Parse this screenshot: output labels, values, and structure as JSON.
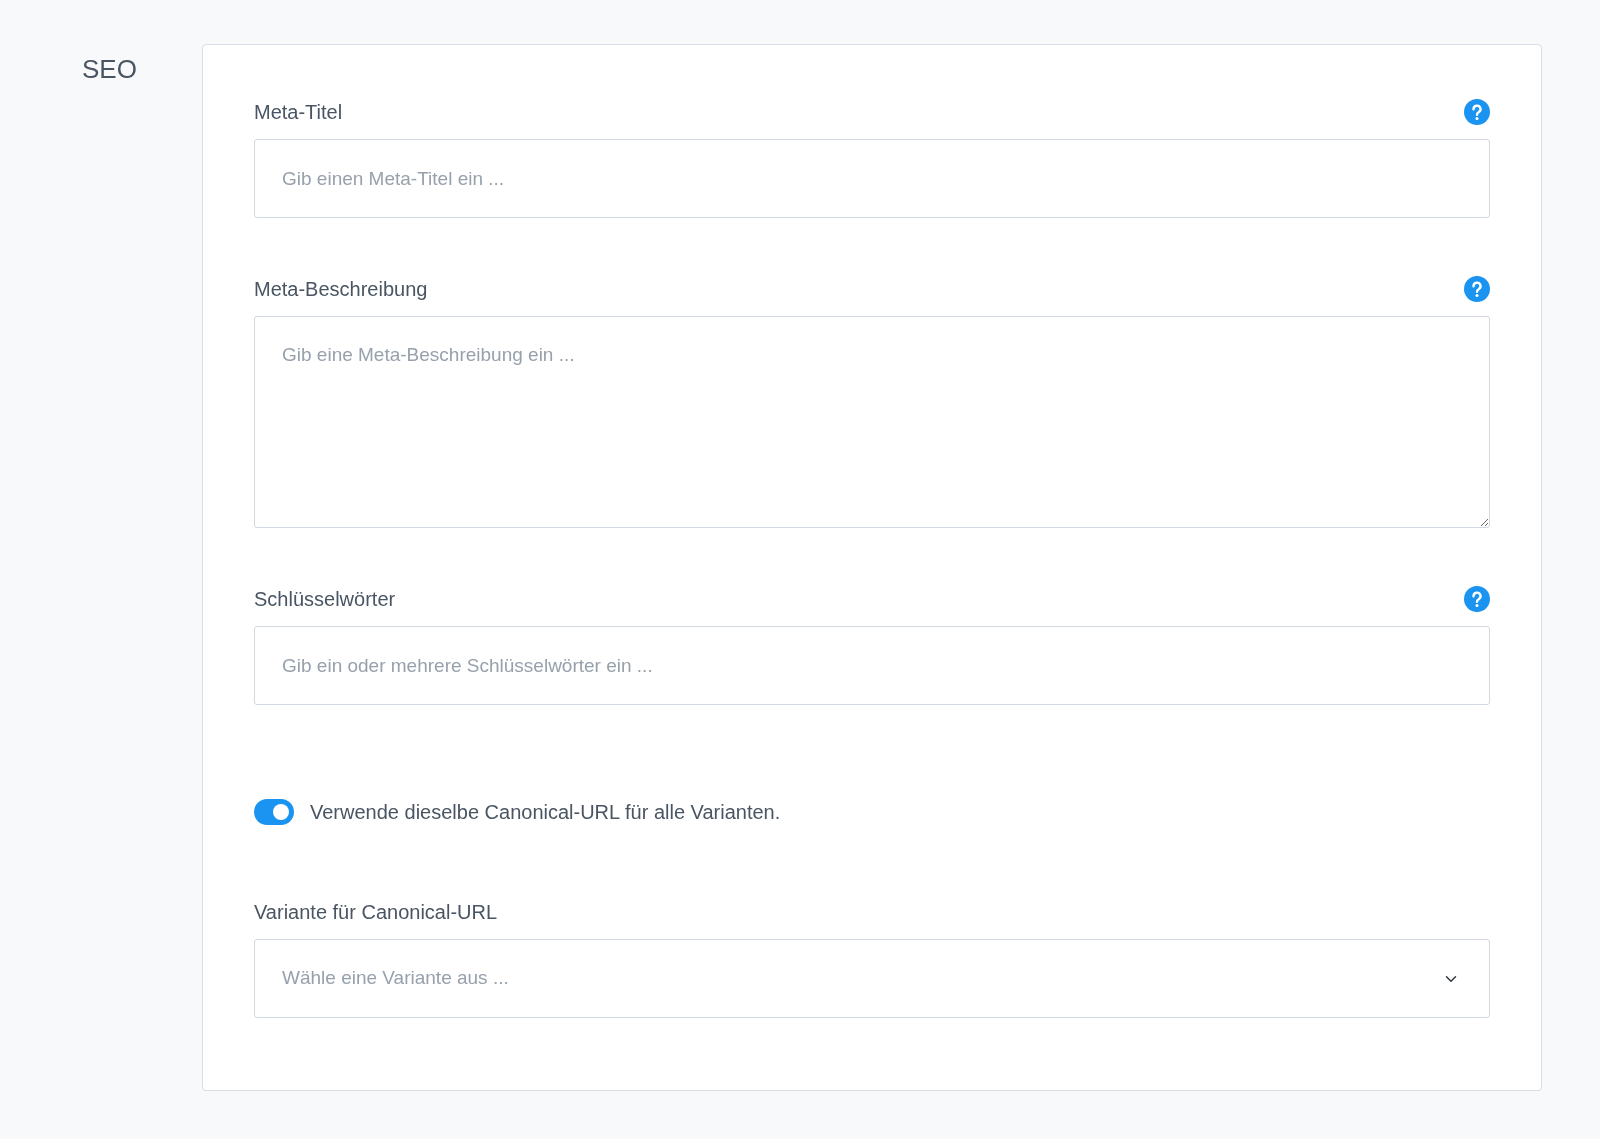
{
  "section_title": "SEO",
  "fields": [
    {
      "kind": "input",
      "label": "Meta-Titel",
      "placeholder": "Gib einen Meta-Titel ein ...",
      "help": true
    },
    {
      "kind": "textarea",
      "label": "Meta-Beschreibung",
      "placeholder": "Gib eine Meta-Beschreibung ein ...",
      "help": true
    },
    {
      "kind": "input",
      "label": "Schlüsselwörter",
      "placeholder": "Gib ein oder mehrere Schlüsselwörter ein ...",
      "help": true
    },
    {
      "kind": "toggle",
      "label": "Verwende dieselbe Canonical-URL für alle Varianten.",
      "on": true
    },
    {
      "kind": "select",
      "label": "Variante für Canonical-URL",
      "placeholder": "Wähle eine Variante aus ..."
    }
  ]
}
